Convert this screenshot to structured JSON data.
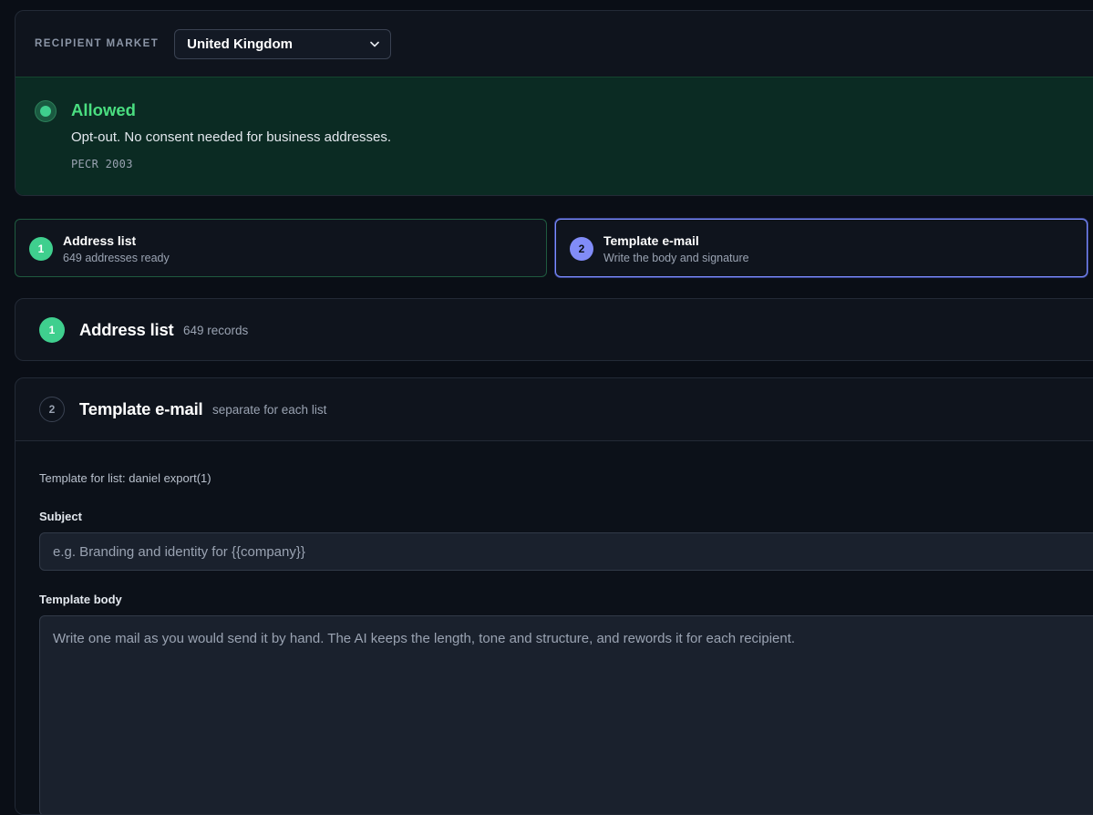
{
  "market": {
    "label": "RECIPIENT MARKET",
    "selected": "United Kingdom",
    "status": {
      "title": "Allowed",
      "description": "Opt-out. No consent needed for business addresses.",
      "regulation": "PECR 2003",
      "color": "#4ade80"
    }
  },
  "steps": [
    {
      "number": "1",
      "title": "Address list",
      "subtitle": "649 addresses ready",
      "state": "done"
    },
    {
      "number": "2",
      "title": "Template e-mail",
      "subtitle": "Write the body and signature",
      "state": "active"
    }
  ],
  "sections": {
    "address_list": {
      "number": "1",
      "title": "Address list",
      "meta": "649 records"
    },
    "template": {
      "number": "2",
      "title": "Template e-mail",
      "meta": "separate for each list",
      "list_note": "Template for list: daniel export(1)",
      "subject_label": "Subject",
      "subject_value": "",
      "subject_placeholder": "e.g. Branding and identity for {{company}}",
      "body_label": "Template body",
      "body_value": "",
      "body_placeholder": "Write one mail as you would send it by hand. The AI keeps the length, tone and structure, and rewords it for each recipient."
    }
  },
  "colors": {
    "accent_green": "#3fcf8e",
    "accent_indigo": "#818cf8",
    "background": "#0a0e16"
  },
  "icons": {
    "select_arrow": "chevron-down-icon",
    "status_indicator": "status-dot-icon"
  }
}
